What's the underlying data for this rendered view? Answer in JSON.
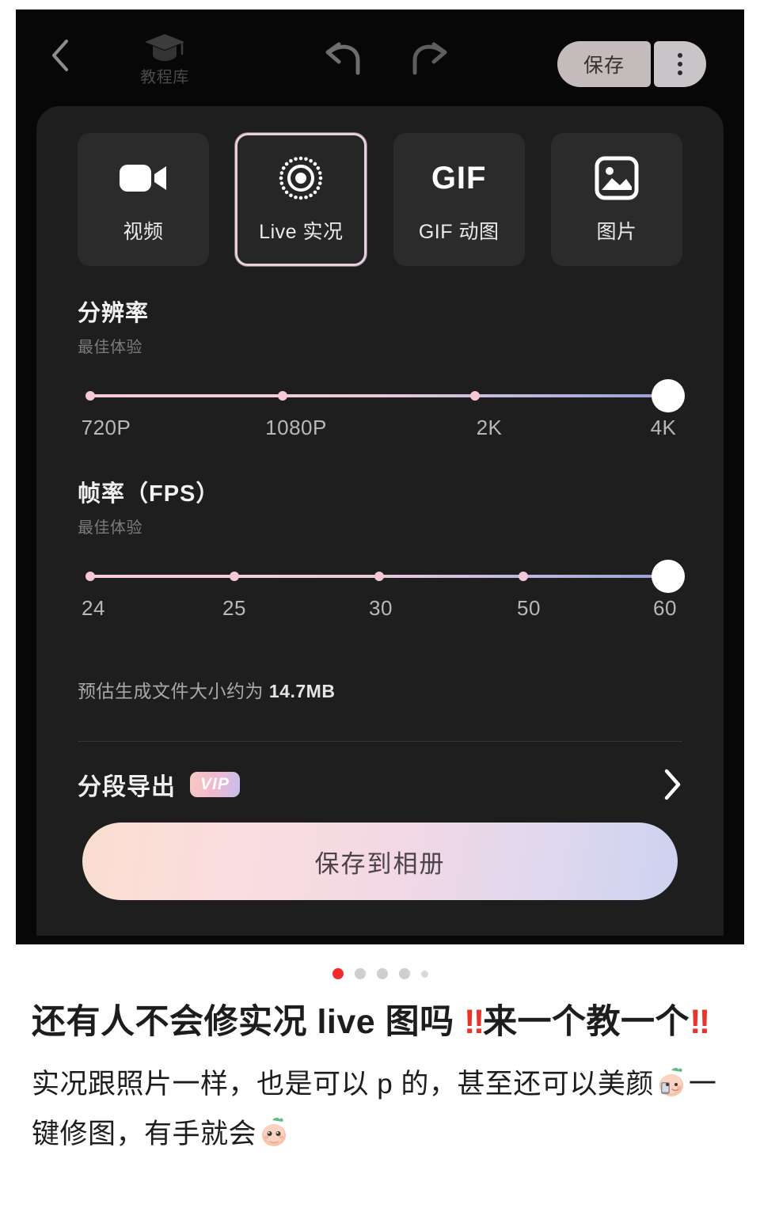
{
  "toolbar": {
    "back_icon": "chevron-left-icon",
    "tutorial_label": "教程库",
    "tutorial_icon": "graduation-cap-icon",
    "undo_icon": "undo-arrow-icon",
    "redo_icon": "redo-arrow-icon",
    "save_label": "保存",
    "menu_icon": "more-vertical-icon"
  },
  "formats": {
    "items": [
      {
        "label": "视频",
        "icon": "video-camera-icon",
        "selected": false
      },
      {
        "label": "Live 实况",
        "icon": "live-photo-icon",
        "selected": true
      },
      {
        "label": "GIF 动图",
        "icon": "gif-text-icon",
        "glyph": "GIF",
        "selected": false
      },
      {
        "label": "图片",
        "icon": "image-picture-icon",
        "selected": false
      }
    ]
  },
  "resolution": {
    "title": "分辨率",
    "subtitle": "最佳体验",
    "options": [
      "720P",
      "1080P",
      "2K",
      "4K"
    ],
    "value": "4K",
    "value_index": 3
  },
  "framerate": {
    "title": "帧率（FPS）",
    "subtitle": "最佳体验",
    "options": [
      "24",
      "25",
      "30",
      "50",
      "60"
    ],
    "value": "60",
    "value_index": 4
  },
  "filesize": {
    "prefix": "预估生成文件大小约为",
    "value": "14.7MB"
  },
  "segment_export": {
    "label": "分段导出",
    "badge": "VIP",
    "chevron_icon": "chevron-right-icon"
  },
  "cta": {
    "label": "保存到相册"
  },
  "pagination": {
    "count": 5,
    "active_index": 0,
    "active_color": "#ef2b2b",
    "inactive_color": "#cfcfcf"
  },
  "caption": {
    "title_part1": "还有人不会修实况 live 图吗 ",
    "title_bangs1": "‼",
    "title_part2": "来一个教一个",
    "title_bangs2": "‼",
    "body_part1": "实况跟照片一样，也是可以 p 的，甚至还可以美颜",
    "body_emoji1": "peach-phone-emoji",
    "body_part2": "一键修图，有手就会",
    "body_emoji2": "peach-face-emoji"
  },
  "colors": {
    "background": "#070707",
    "panel": "#1e1e1e",
    "tab": "#2b2b2b",
    "accent_pink": "#f6ccd6",
    "accent_lavender": "#9aa2d4",
    "text_primary": "#f2f0f0",
    "text_muted": "#7b7b7b"
  }
}
